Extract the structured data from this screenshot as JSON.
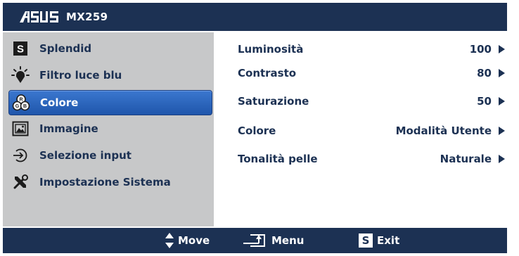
{
  "header": {
    "brand": "ASUS",
    "model": "MX259"
  },
  "menu": {
    "items": [
      {
        "label": "Splendid",
        "icon": "splendid-s-icon"
      },
      {
        "label": "Filtro luce blu",
        "icon": "blue-light-bulb-icon"
      },
      {
        "label": "Colore",
        "icon": "color-rgb-icon",
        "selected": true
      },
      {
        "label": "Immagine",
        "icon": "image-icon"
      },
      {
        "label": "Selezione input",
        "icon": "input-select-icon"
      },
      {
        "label": "Impostazione Sistema",
        "icon": "system-tools-icon"
      }
    ]
  },
  "settings": [
    {
      "label": "Luminosità",
      "value": "100"
    },
    {
      "label": "Contrasto",
      "value": "80"
    },
    {
      "label": "Saturazione",
      "value": "50"
    },
    {
      "label": "Colore",
      "value": "Modalità Utente"
    },
    {
      "label": "Tonalità pelle",
      "value": "Naturale"
    }
  ],
  "footer": {
    "move": "Move",
    "menu": "Menu",
    "exit": "Exit",
    "exit_key": "S"
  },
  "colors": {
    "navy": "#1c3153",
    "panel_gray": "#c7c8c9",
    "highlight": "#2a63bd",
    "white": "#ffffff"
  }
}
